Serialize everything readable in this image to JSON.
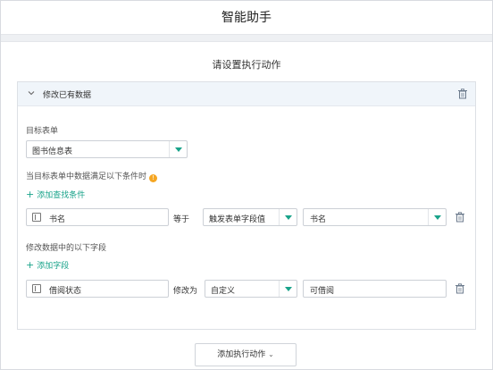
{
  "window": {
    "title": "智能助手"
  },
  "heading": "请设置执行动作",
  "action_card": {
    "title": "修改已有数据",
    "target_form": {
      "label": "目标表单",
      "value": "图书信息表"
    },
    "condition": {
      "label": "当目标表单中数据满足以下条件时",
      "add_link": "添加查找条件",
      "field": "书名",
      "operator": "等于",
      "value_type": "触发表单字段值",
      "value": "书名"
    },
    "modify": {
      "label": "修改数据中的以下字段",
      "add_link": "添加字段",
      "field": "借阅状态",
      "operator": "修改为",
      "value_type": "自定义",
      "value": "可借阅"
    }
  },
  "footer": {
    "add_action_button": "添加执行动作"
  },
  "colors": {
    "accent": "#19a38a",
    "warning": "#f5a623",
    "header_bg": "#f0f5fa"
  },
  "icons": [
    "chevron-down-icon",
    "trash-icon",
    "info-icon",
    "plus-icon",
    "field-icon"
  ]
}
